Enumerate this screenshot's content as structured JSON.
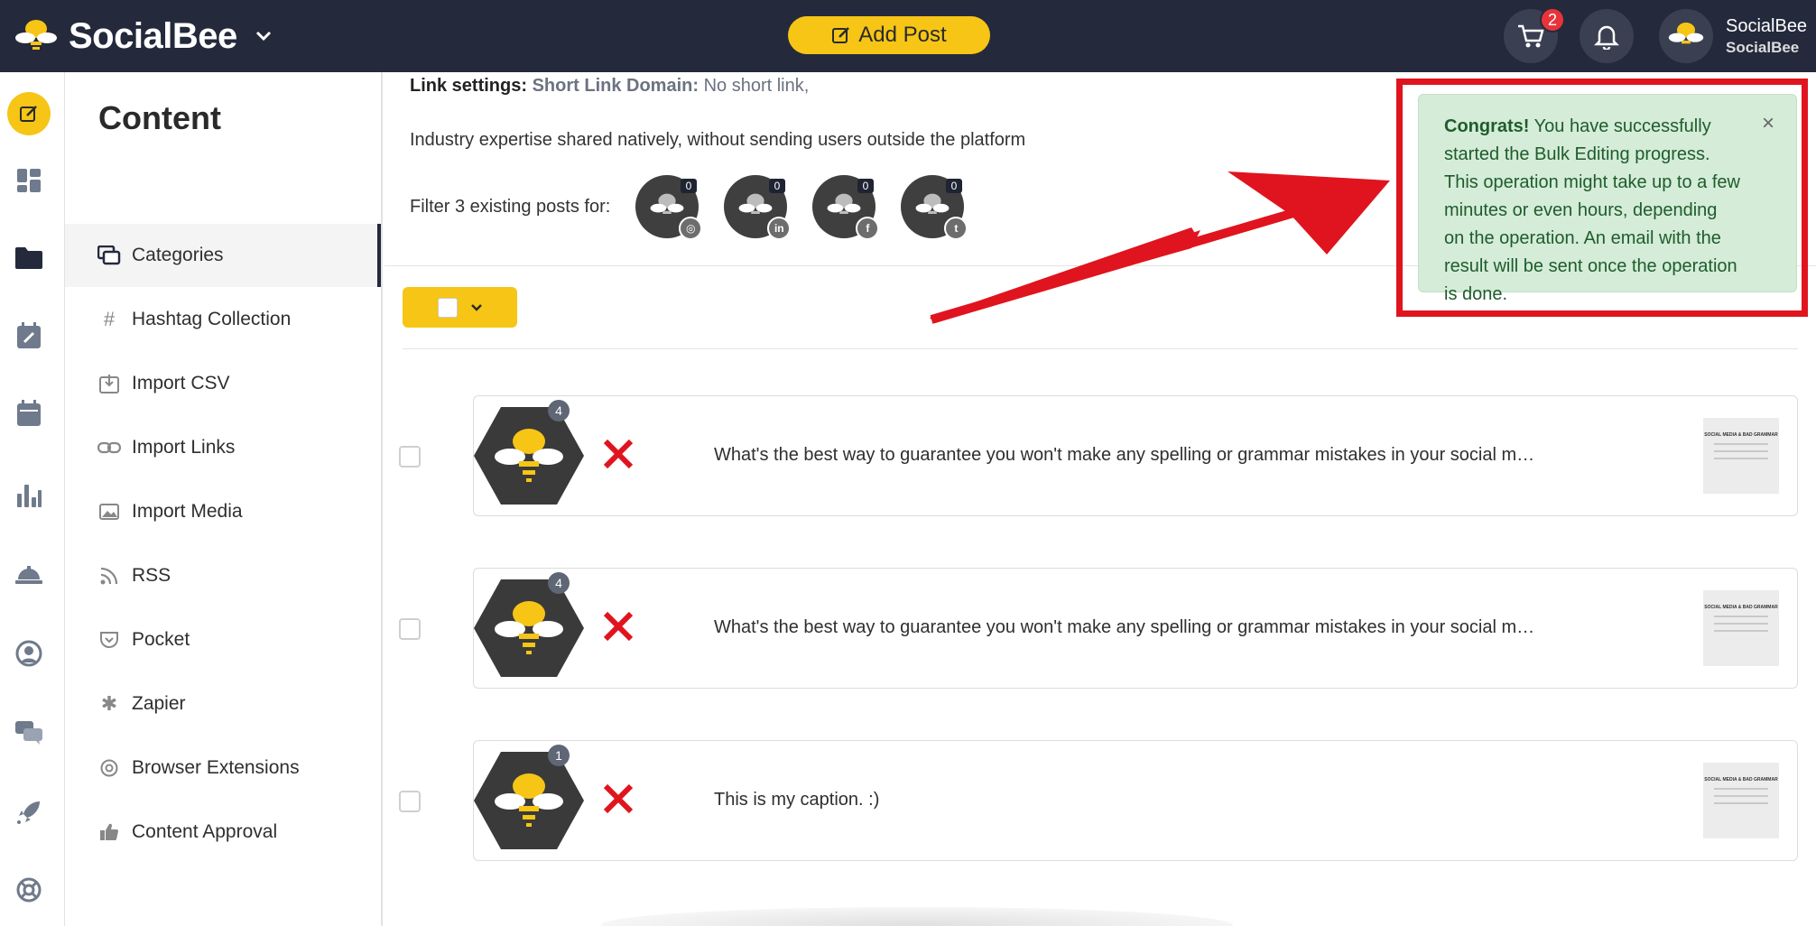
{
  "brand": {
    "name": "SocialBee",
    "accent": "#f6c516",
    "dark": "#242a3c",
    "alert_red": "#e0141e"
  },
  "header": {
    "add_post_label": "Add Post",
    "cart_count": "2",
    "user_name": "SocialBee",
    "user_workspace": "SocialBee"
  },
  "rail": [
    "edit-icon",
    "dashboard-icon",
    "folder-icon",
    "calendar-edit-icon",
    "calendar-icon",
    "analytics-icon",
    "concierge-icon",
    "audience-icon",
    "chat-icon",
    "rocket-icon",
    "help-icon"
  ],
  "sidebar": {
    "title": "Content",
    "items": [
      {
        "label": "Categories",
        "icon": "categories-icon"
      },
      {
        "label": "Hashtag Collection",
        "icon": "hashtag-icon"
      },
      {
        "label": "Import CSV",
        "icon": "import-csv-icon"
      },
      {
        "label": "Import Links",
        "icon": "link-icon"
      },
      {
        "label": "Import Media",
        "icon": "image-icon"
      },
      {
        "label": "RSS",
        "icon": "rss-icon"
      },
      {
        "label": "Pocket",
        "icon": "pocket-icon"
      },
      {
        "label": "Zapier",
        "icon": "zapier-icon"
      },
      {
        "label": "Browser Extensions",
        "icon": "chrome-icon"
      },
      {
        "label": "Content Approval",
        "icon": "thumbs-up-icon"
      }
    ]
  },
  "main": {
    "link_settings_label": "Link settings:",
    "short_link_domain_label": "Short Link Domain:",
    "short_link_domain_value": "No short link,",
    "description": "Industry expertise shared natively, without sending users outside the platform",
    "filter_label": "Filter 3 existing posts for:",
    "networks": [
      {
        "name": "instagram",
        "count": "0",
        "badge": "◎"
      },
      {
        "name": "linkedin",
        "count": "0",
        "badge": "in"
      },
      {
        "name": "facebook",
        "count": "0",
        "badge": "f"
      },
      {
        "name": "twitter",
        "count": "0",
        "badge": "t"
      }
    ],
    "posts": [
      {
        "count": "4",
        "text": "What's the best way to guarantee you won't make any spelling or grammar mistakes in your social m…",
        "thumb_title": "SOCIAL MEDIA & BAD GRAMMAR"
      },
      {
        "count": "4",
        "text": "What's the best way to guarantee you won't make any spelling or grammar mistakes in your social m…",
        "thumb_title": "SOCIAL MEDIA & BAD GRAMMAR"
      },
      {
        "count": "1",
        "text": "This is my caption. :)",
        "thumb_title": "SOCIAL MEDIA & BAD GRAMMAR"
      }
    ]
  },
  "toast": {
    "strong": "Congrats!",
    "message": " You have successfully started the Bulk Editing progress. This operation might take up to a few minutes or even hours, depending on the operation. An email with the result will be sent once the operation is done.",
    "close": "×"
  }
}
